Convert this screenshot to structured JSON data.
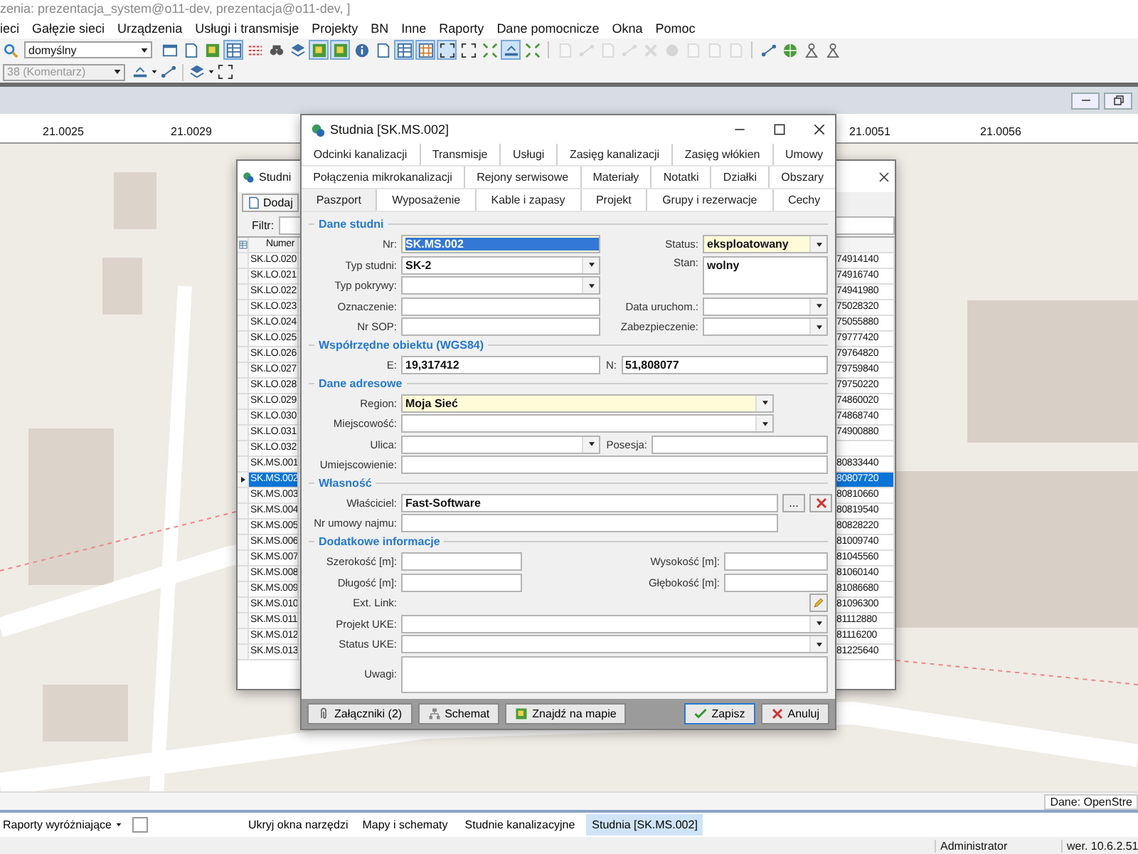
{
  "window": {
    "title": "zenia: prezentacja_system@o11-dev, prezentacja@o11-dev, ]"
  },
  "menu": [
    {
      "label": "ieci"
    },
    {
      "label": "Gałęzie sieci"
    },
    {
      "label": "Urządzenia"
    },
    {
      "label": "Usługi i transmisje"
    },
    {
      "label": "Projekty"
    },
    {
      "label": "BN"
    },
    {
      "label": "Inne"
    },
    {
      "label": "Raporty"
    },
    {
      "label": "Dane pomocnicze"
    },
    {
      "label": "Okna"
    },
    {
      "label": "Pomoc"
    }
  ],
  "toolbar": {
    "view_combo": "domyślny",
    "buttons": [
      {
        "pressed": false,
        "disabled": false
      },
      {
        "pressed": false,
        "disabled": false
      },
      {
        "pressed": false,
        "disabled": false
      },
      {
        "pressed": true,
        "disabled": false
      },
      {
        "pressed": false,
        "disabled": false
      },
      {
        "pressed": false,
        "disabled": false
      },
      {
        "pressed": false,
        "disabled": false
      },
      {
        "pressed": true,
        "disabled": false
      },
      {
        "pressed": true,
        "disabled": false
      },
      {
        "pressed": false,
        "disabled": false
      },
      {
        "pressed": false,
        "disabled": false
      },
      {
        "pressed": true,
        "disabled": false
      },
      {
        "pressed": true,
        "disabled": false
      },
      {
        "pressed": true,
        "disabled": false
      },
      {
        "pressed": false,
        "disabled": false
      },
      {
        "pressed": false,
        "disabled": false
      },
      {
        "pressed": true,
        "disabled": false
      },
      {
        "pressed": false,
        "disabled": false
      },
      {
        "pressed": false,
        "disabled": true
      },
      {
        "pressed": false,
        "disabled": true
      },
      {
        "pressed": false,
        "disabled": true
      },
      {
        "pressed": false,
        "disabled": true
      },
      {
        "pressed": false,
        "disabled": true
      },
      {
        "pressed": false,
        "disabled": true
      },
      {
        "pressed": false,
        "disabled": true
      },
      {
        "pressed": false,
        "disabled": true
      },
      {
        "pressed": false,
        "disabled": true
      },
      {
        "pressed": false,
        "disabled": false
      },
      {
        "pressed": false,
        "disabled": false
      },
      {
        "pressed": false,
        "disabled": false
      },
      {
        "pressed": false,
        "disabled": false
      }
    ]
  },
  "toolbar_2": {
    "layer_combo": {
      "value": "38 (Komentarz)",
      "disabled": true
    }
  },
  "ruler": {
    "labels": [
      "21.0025",
      "21.0029",
      "21.0051",
      "21.0056"
    ]
  },
  "list_window": {
    "title": "Studni",
    "add_button": "Dodaj",
    "filter_label": "Filtr:",
    "columns": [
      "Numer"
    ],
    "rows": [
      {
        "number": "SK.LO.020",
        "column_2": "74914140",
        "selected": false
      },
      {
        "number": "SK.LO.021",
        "column_2": "74916740",
        "selected": false
      },
      {
        "number": "SK.LO.022",
        "column_2": "74941980",
        "selected": false
      },
      {
        "number": "SK.LO.023",
        "column_2": "75028320",
        "selected": false
      },
      {
        "number": "SK.LO.024",
        "column_2": "75055880",
        "selected": false
      },
      {
        "number": "SK.LO.025",
        "column_2": "79777420",
        "selected": false
      },
      {
        "number": "SK.LO.026",
        "column_2": "79764820",
        "selected": false
      },
      {
        "number": "SK.LO.027",
        "column_2": "79759840",
        "selected": false
      },
      {
        "number": "SK.LO.028",
        "column_2": "79750220",
        "selected": false
      },
      {
        "number": "SK.LO.029",
        "column_2": "74860020",
        "selected": false
      },
      {
        "number": "SK.LO.030",
        "column_2": "74868740",
        "selected": false
      },
      {
        "number": "SK.LO.031",
        "column_2": "74900880",
        "selected": false
      },
      {
        "number": "SK.LO.032",
        "selected": false
      },
      {
        "number": "SK.MS.001",
        "column_2": "80833440",
        "selected": false
      },
      {
        "number": "SK.MS.002",
        "column_2": "80807720",
        "selected": true
      },
      {
        "number": "SK.MS.003",
        "column_2": "80810660",
        "selected": false
      },
      {
        "number": "SK.MS.004",
        "column_2": "80819540",
        "selected": false
      },
      {
        "number": "SK.MS.005",
        "column_2": "80828220",
        "selected": false
      },
      {
        "number": "SK.MS.006",
        "column_2": "81009740",
        "selected": false
      },
      {
        "number": "SK.MS.007",
        "column_2": "81045560",
        "selected": false
      },
      {
        "number": "SK.MS.008",
        "column_2": "81060140",
        "selected": false
      },
      {
        "number": "SK.MS.009",
        "column_2": "81086680",
        "selected": false
      },
      {
        "number": "SK.MS.010",
        "column_2": "81096300",
        "selected": false
      },
      {
        "number": "SK.MS.011",
        "column_2": "81112880",
        "selected": false
      },
      {
        "number": "SK.MS.012",
        "column_2": "81116200",
        "selected": false
      },
      {
        "number": "SK.MS.013",
        "column_2": "81225640",
        "selected": false
      }
    ]
  },
  "dialog": {
    "title": "Studnia [SK.MS.002]",
    "tab_rows": [
      [
        {
          "label": "Odcinki kanalizacji",
          "selected": false
        },
        {
          "label": "Transmisje",
          "selected": false
        },
        {
          "label": "Usługi",
          "selected": false
        },
        {
          "label": "Zasięg kanalizacji",
          "selected": false
        },
        {
          "label": "Zasięg włókien",
          "selected": false
        },
        {
          "label": "Umowy",
          "selected": false
        }
      ],
      [
        {
          "label": "Połączenia mikrokanalizacji",
          "selected": false
        },
        {
          "label": "Rejony serwisowe",
          "selected": false
        },
        {
          "label": "Materiały",
          "selected": false
        },
        {
          "label": "Notatki",
          "selected": false
        },
        {
          "label": "Działki",
          "selected": false
        },
        {
          "label": "Obszary",
          "selected": false
        }
      ],
      [
        {
          "label": "Paszport",
          "selected": true
        },
        {
          "label": "Wyposażenie",
          "selected": false
        },
        {
          "label": "Kable i zapasy",
          "selected": false
        },
        {
          "label": "Projekt",
          "selected": false
        },
        {
          "label": "Grupy i rezerwacje",
          "selected": false
        },
        {
          "label": "Cechy",
          "selected": false
        }
      ]
    ],
    "well": {
      "title": "Dane studni",
      "left": [
        {
          "label": "Nr:",
          "kind": "text",
          "value": "SK.MS.002",
          "required": true,
          "text_selected": true
        },
        {
          "label": "Typ studni:",
          "kind": "combo",
          "value": "SK-2",
          "required": false
        },
        {
          "label": "Typ pokrywy:",
          "kind": "combo",
          "required": false
        },
        {
          "label": "Oznaczenie:",
          "kind": "text",
          "required": false
        },
        {
          "label": "Nr SOP:",
          "kind": "text",
          "required": false
        }
      ],
      "right": [
        {
          "label": "Status:",
          "kind": "combo",
          "value": "eksploatowany",
          "required": true
        },
        {
          "label": "Stan:",
          "kind": "memo",
          "value": "wolny",
          "required": false
        },
        {
          "label": "Data uruchom.:",
          "kind": "combo",
          "required": false
        },
        {
          "label": "Zabezpieczenie:",
          "kind": "combo",
          "required": false
        }
      ]
    },
    "coordinates": {
      "title": "Współrzędne obiektu (WGS84)",
      "left": [
        {
          "label": "E:",
          "kind": "text",
          "value": "19,317412",
          "required": false
        }
      ],
      "right": [
        {
          "label": "N:",
          "kind": "text",
          "value": "51,808077",
          "required": false
        }
      ]
    },
    "address": {
      "title": "Dane adresowe",
      "fields": [
        {
          "label": "Region:",
          "kind": "combo",
          "value": "Moja Sieć",
          "required": true
        },
        {
          "label": "Miejscowość:",
          "kind": "combo",
          "required": false
        },
        {
          "label": "Ulica:",
          "kind": "combo",
          "required": false
        },
        {
          "label": "Posesja:",
          "kind": "text",
          "required": false
        },
        {
          "label": "Umiejscowienie:",
          "kind": "text",
          "required": false
        }
      ]
    },
    "ownership": {
      "title": "Własność",
      "owner": {
        "label": "Właściciel:",
        "value": "Fast-Software"
      },
      "browse_button": "...",
      "lease": {
        "label": "Nr umowy najmu:"
      }
    },
    "extra": {
      "title": "Dodatkowe informacje",
      "left": [
        {
          "label": "Szerokość [m]:",
          "kind": "text",
          "required": false
        },
        {
          "label": "Długość [m]:",
          "kind": "text",
          "required": false
        }
      ],
      "right": [
        {
          "label": "Wysokość [m]:",
          "kind": "text",
          "required": false
        },
        {
          "label": "Głębokość [m]:",
          "kind": "text",
          "required": false
        }
      ],
      "ext_link": {
        "label": "Ext. Link:"
      },
      "fields": [
        {
          "label": "Projekt UKE:",
          "kind": "combo",
          "required": false
        },
        {
          "label": "Status UKE:",
          "kind": "combo",
          "required": false
        },
        {
          "label": "Uwagi:",
          "kind": "memo",
          "required": false
        }
      ]
    },
    "footer": {
      "left": [
        {
          "label": "Załączniki (2)"
        },
        {
          "label": "Schemat"
        },
        {
          "label": "Znajdź na mapie"
        }
      ],
      "right": [
        {
          "label": "Zapisz",
          "default": true
        },
        {
          "label": "Anuluj",
          "default": false
        }
      ]
    }
  },
  "map": {
    "attribution": "Dane: OpenStre"
  },
  "taskbar": {
    "reports_button": "Raporty wyróżniające",
    "checkbox": {
      "checked": false
    },
    "hide_tools": "Ukryj okna narzędzi",
    "tabs": [
      {
        "label": "Mapy i schematy",
        "selected": false
      },
      {
        "label": "Studnie kanalizacyjne",
        "selected": false
      },
      {
        "label": "Studnia [SK.MS.002]",
        "selected": true
      }
    ]
  },
  "status_bar": [
    {
      "text": "Administrator"
    },
    {
      "text": "wer. 10.6.2.51"
    }
  ]
}
